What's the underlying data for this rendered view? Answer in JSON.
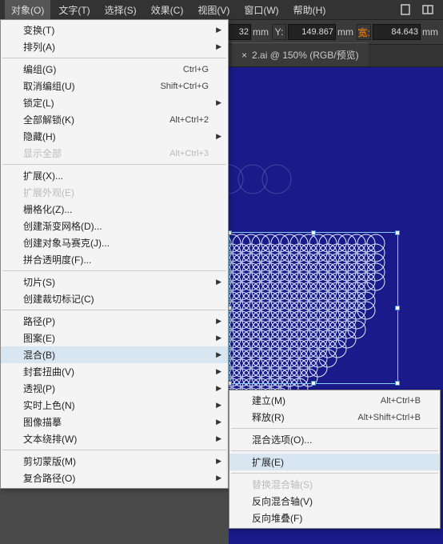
{
  "menubar": {
    "items": [
      "对象(O)",
      "文字(T)",
      "选择(S)",
      "效果(C)",
      "视图(V)",
      "窗口(W)",
      "帮助(H)"
    ]
  },
  "toolbar": {
    "field1_value": "32",
    "unit1": "mm",
    "y_label": "Y:",
    "y_value": "149.867",
    "unit2": "mm",
    "w_label": "宽:",
    "w_value": "84.643",
    "unit3": "mm"
  },
  "tab": {
    "title": "2.ai @ 150% (RGB/预览)",
    "close": "×"
  },
  "menu": {
    "groups": [
      [
        {
          "label": "变换(T)",
          "arrow": true
        },
        {
          "label": "排列(A)",
          "arrow": true
        }
      ],
      [
        {
          "label": "编组(G)",
          "shortcut": "Ctrl+G"
        },
        {
          "label": "取消编组(U)",
          "shortcut": "Shift+Ctrl+G"
        },
        {
          "label": "锁定(L)",
          "arrow": true
        },
        {
          "label": "全部解锁(K)",
          "shortcut": "Alt+Ctrl+2"
        },
        {
          "label": "隐藏(H)",
          "arrow": true
        },
        {
          "label": "显示全部",
          "shortcut": "Alt+Ctrl+3",
          "disabled": true
        }
      ],
      [
        {
          "label": "扩展(X)..."
        },
        {
          "label": "扩展外观(E)",
          "disabled": true
        },
        {
          "label": "栅格化(Z)..."
        },
        {
          "label": "创建渐变网格(D)..."
        },
        {
          "label": "创建对象马赛克(J)..."
        },
        {
          "label": "拼合透明度(F)..."
        }
      ],
      [
        {
          "label": "切片(S)",
          "arrow": true
        },
        {
          "label": "创建裁切标记(C)"
        }
      ],
      [
        {
          "label": "路径(P)",
          "arrow": true
        },
        {
          "label": "图案(E)",
          "arrow": true
        },
        {
          "label": "混合(B)",
          "arrow": true,
          "highlight": true
        },
        {
          "label": "封套扭曲(V)",
          "arrow": true
        },
        {
          "label": "透视(P)",
          "arrow": true
        },
        {
          "label": "实时上色(N)",
          "arrow": true
        },
        {
          "label": "图像描摹",
          "arrow": true
        },
        {
          "label": "文本绕排(W)",
          "arrow": true
        }
      ],
      [
        {
          "label": "剪切蒙版(M)",
          "arrow": true
        },
        {
          "label": "复合路径(O)",
          "arrow": true
        }
      ]
    ]
  },
  "submenu": {
    "groups": [
      [
        {
          "label": "建立(M)",
          "shortcut": "Alt+Ctrl+B"
        },
        {
          "label": "释放(R)",
          "shortcut": "Alt+Shift+Ctrl+B"
        }
      ],
      [
        {
          "label": "混合选项(O)..."
        }
      ],
      [
        {
          "label": "扩展(E)",
          "highlight": true
        }
      ],
      [
        {
          "label": "替换混合轴(S)",
          "disabled": true
        },
        {
          "label": "反向混合轴(V)"
        },
        {
          "label": "反向堆叠(F)"
        }
      ]
    ]
  }
}
